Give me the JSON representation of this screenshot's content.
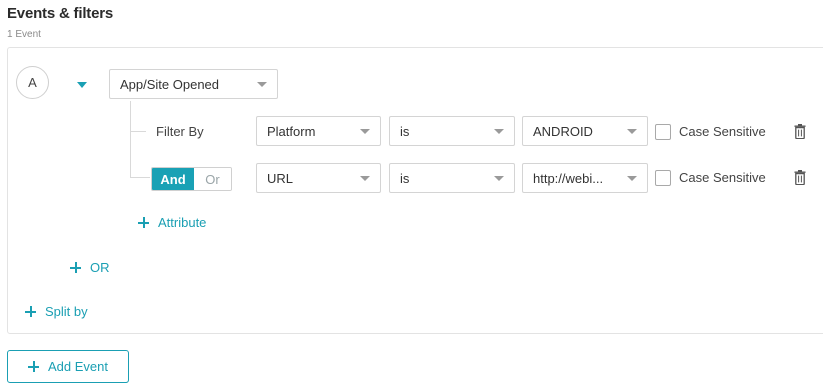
{
  "header": {
    "title": "Events & filters",
    "subtitle": "1 Event"
  },
  "event": {
    "badge": "A",
    "event_name": "App/Site Opened",
    "filter_by_label": "Filter By",
    "filters": [
      {
        "property": "Platform",
        "operator": "is",
        "value": "ANDROID",
        "case_sensitive_label": "Case Sensitive",
        "case_sensitive": false
      },
      {
        "property": "URL",
        "operator": "is",
        "value": "http://webi...",
        "case_sensitive_label": "Case Sensitive",
        "case_sensitive": false
      }
    ],
    "conjunction": {
      "and_label": "And",
      "or_label": "Or",
      "selected": "And"
    },
    "add_attribute_label": "Attribute",
    "add_or_label": "OR"
  },
  "split_by_label": "Split by",
  "add_event_label": "Add Event",
  "colors": {
    "accent": "#1a9fb3",
    "border": "#d4d4d4",
    "text": "#333333"
  },
  "icons": {
    "caret": "caret-down-icon",
    "trash": "trash-icon",
    "plus": "plus-icon"
  }
}
